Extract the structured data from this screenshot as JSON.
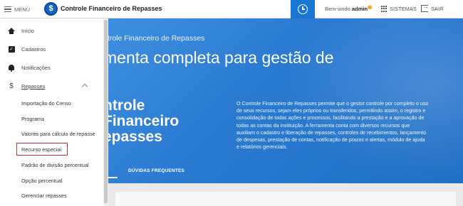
{
  "header": {
    "menu_label": "MENU",
    "logo_glyph": "$",
    "app_title": "Controle Financeiro de Repasses",
    "welcome_prefix": "Bem-vindo",
    "user": "admin",
    "systems_label": "SISTEMAS",
    "logout_label": "SAIR",
    "accent_color": "#1976d2"
  },
  "sidebar": {
    "items": [
      {
        "label": "Início",
        "icon": "home-icon"
      },
      {
        "label": "Cadastros",
        "icon": "checkbox-icon"
      },
      {
        "label": "Notificações",
        "icon": "bell-icon"
      },
      {
        "label": "Repasses",
        "icon": "dollar-icon",
        "expanded": true
      }
    ],
    "dollar_glyph": "$",
    "check_glyph": "✓",
    "subitems": [
      {
        "label": "Importação do Censo"
      },
      {
        "label": "Programa"
      },
      {
        "label": "Valores para cálculo de repasse"
      },
      {
        "label": "Recurso especial",
        "highlighted": true
      },
      {
        "label": "Padrão de divisão percentual"
      },
      {
        "label": "Opção percentual"
      },
      {
        "label": "Gerenciar repasses"
      }
    ]
  },
  "hero": {
    "small_title": "ntrole Financeiro de Repasses",
    "big_title": "menta completa para gestão de",
    "heading_line1": "ntrole Financeiro",
    "heading_line2": "epasses",
    "description": "O Controle Financeiro de Repasses permite que o gestor controle por completo o uso de seus recursos, sejam eles próprios ou transferidos, permitindo assim, o registro e consolidação de todas ações e processos, facilitando a prestação e a aprovação de todas as contas da instituição. A ferramenta conta com diversos recursos que auxiliam o cadastro e liberação de repasses, controles de recebimentos, lançamento de despesas, prestação de contas, notificação de prazos e alertas, módulo de ajuda e relatórios gerenciais.",
    "tab_label": "DÚVIDAS FREQUENTES",
    "bg_color": "#2b7bd3"
  }
}
